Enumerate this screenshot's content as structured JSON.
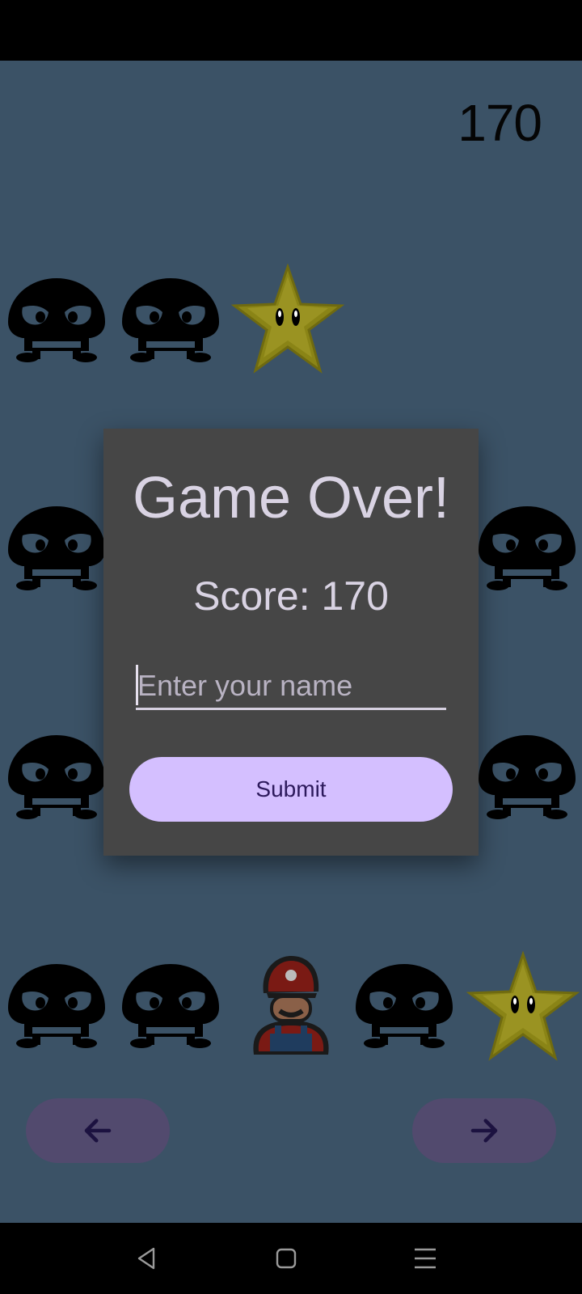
{
  "game": {
    "score": "170"
  },
  "sprites": [
    {
      "type": "goomba-icon"
    },
    {
      "type": "goomba-icon"
    },
    {
      "type": "star-icon"
    },
    {
      "type": "goomba-icon"
    },
    {
      "type": "goomba-icon"
    },
    {
      "type": "goomba-icon"
    },
    {
      "type": "goomba-icon"
    },
    {
      "type": "goomba-icon"
    },
    {
      "type": "goomba-icon"
    },
    {
      "type": "mario-icon"
    },
    {
      "type": "goomba-icon"
    },
    {
      "type": "star-icon"
    }
  ],
  "dialog": {
    "title": "Game Over!",
    "score_text": "Score: 170",
    "name_placeholder": "Enter your name",
    "submit_label": "Submit"
  },
  "controls": {
    "left_icon": "arrow-left-icon",
    "right_icon": "arrow-right-icon"
  },
  "system_nav": {
    "back_icon": "triangle-back-icon",
    "home_icon": "square-home-icon",
    "menu_icon": "menu-lines-icon"
  },
  "colors": {
    "background": "#3b5266",
    "dialog": "#464646",
    "button": "#d4bfff",
    "nav_button": "#524a6e"
  }
}
